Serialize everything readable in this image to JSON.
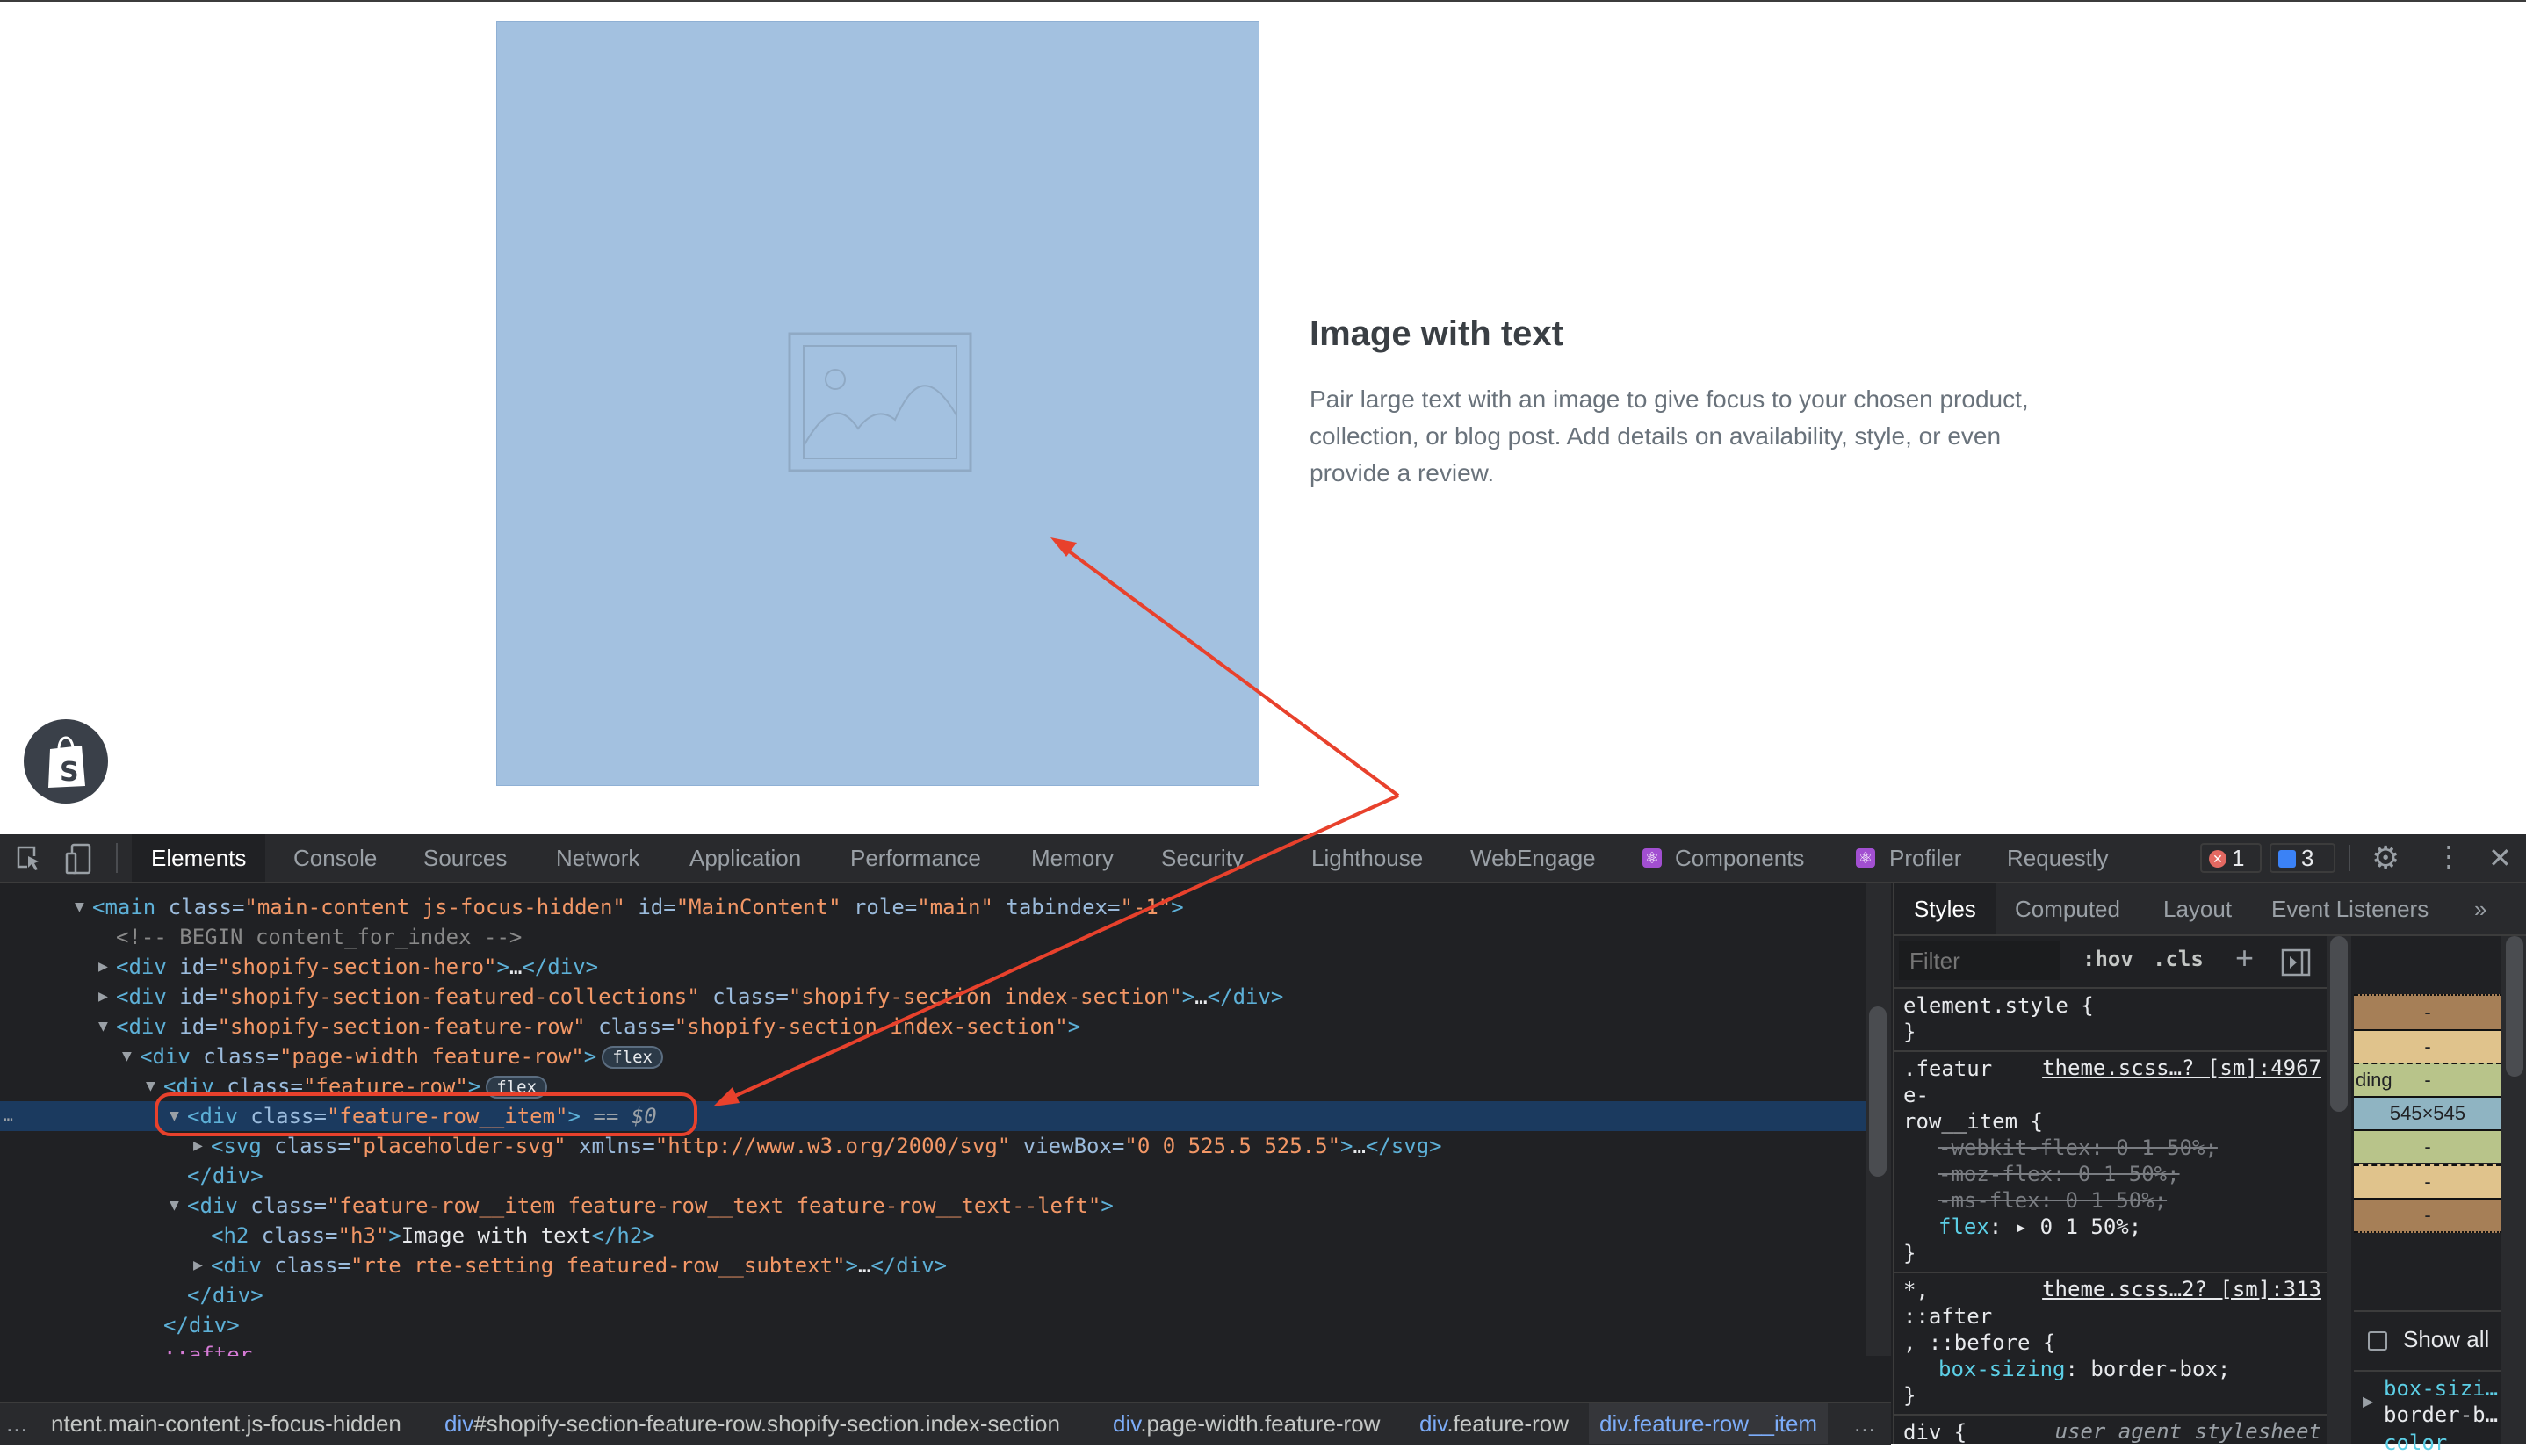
{
  "page": {
    "heading": "Image with text",
    "body": "Pair large text with an image to give focus to your chosen product, collection, or blog post. Add details on availability, style, or even provide a review.",
    "image_color": "#a3c1e0",
    "placeholder_icon": "image-placeholder-icon",
    "badge_icon": "shopify-bag-icon"
  },
  "devtools": {
    "tabs": [
      "Elements",
      "Console",
      "Sources",
      "Network",
      "Application",
      "Performance",
      "Memory",
      "Security",
      "Lighthouse",
      "WebEngage",
      "Components",
      "Profiler",
      "Requestly"
    ],
    "active_tab": "Elements",
    "error_count": "1",
    "message_count": "3",
    "elements_rows": [
      {
        "indent": 0,
        "arrow": "open",
        "tokens": [
          [
            "tag",
            "<main"
          ],
          [
            "attr",
            " class="
          ],
          [
            "val",
            "\"main-content js-focus-hidden\""
          ],
          [
            "attr",
            " id="
          ],
          [
            "val",
            "\"MainContent\""
          ],
          [
            "attr",
            " role="
          ],
          [
            "val",
            "\"main\""
          ],
          [
            "attr",
            " tabindex="
          ],
          [
            "val",
            "\"-1\""
          ],
          [
            "tag",
            ">"
          ]
        ]
      },
      {
        "indent": 1,
        "tokens": [
          [
            "comment",
            "<!-- BEGIN content_for_index -->"
          ]
        ]
      },
      {
        "indent": 1,
        "arrow": "closed",
        "tokens": [
          [
            "tag",
            "<div"
          ],
          [
            "attr",
            " id="
          ],
          [
            "val",
            "\"shopify-section-hero\""
          ],
          [
            "tag",
            ">"
          ],
          [
            "text",
            "…"
          ],
          [
            "tag",
            "</div>"
          ]
        ]
      },
      {
        "indent": 1,
        "arrow": "closed",
        "tokens": [
          [
            "tag",
            "<div"
          ],
          [
            "attr",
            " id="
          ],
          [
            "val",
            "\"shopify-section-featured-collections\""
          ],
          [
            "attr",
            " class="
          ],
          [
            "val",
            "\"shopify-section index-section\""
          ],
          [
            "tag",
            ">"
          ],
          [
            "text",
            "…"
          ],
          [
            "tag",
            "</div>"
          ]
        ]
      },
      {
        "indent": 1,
        "arrow": "open",
        "tokens": [
          [
            "tag",
            "<div"
          ],
          [
            "attr",
            " id="
          ],
          [
            "val",
            "\"shopify-section-feature-row\""
          ],
          [
            "attr",
            " class="
          ],
          [
            "val",
            "\"shopify-section index-section\""
          ],
          [
            "tag",
            ">"
          ]
        ]
      },
      {
        "indent": 2,
        "arrow": "open",
        "tokens": [
          [
            "tag",
            "<div"
          ],
          [
            "attr",
            " class="
          ],
          [
            "val",
            "\"page-width feature-row\""
          ],
          [
            "tag",
            ">"
          ],
          [
            "badge",
            "flex"
          ]
        ]
      },
      {
        "indent": 3,
        "arrow": "open",
        "tokens": [
          [
            "tag",
            "<div"
          ],
          [
            "attr",
            " class="
          ],
          [
            "val",
            "\"feature-row\""
          ],
          [
            "tag",
            ">"
          ],
          [
            "badge",
            "flex"
          ]
        ]
      },
      {
        "indent": 4,
        "arrow": "open",
        "selected": true,
        "tokens": [
          [
            "tag",
            "<div"
          ],
          [
            "attr",
            " class="
          ],
          [
            "val",
            "\"feature-row__item\""
          ],
          [
            "tag",
            ">"
          ],
          [
            "eq",
            " == $0"
          ]
        ]
      },
      {
        "indent": 5,
        "arrow": "closed",
        "tokens": [
          [
            "tag",
            "<svg"
          ],
          [
            "attr",
            " class="
          ],
          [
            "val",
            "\"placeholder-svg\""
          ],
          [
            "attr",
            " xmlns="
          ],
          [
            "val",
            "\"http://www.w3.org/2000/svg\""
          ],
          [
            "attr",
            " viewBox="
          ],
          [
            "val",
            "\"0 0 525.5 525.5\""
          ],
          [
            "tag",
            ">"
          ],
          [
            "text",
            "…"
          ],
          [
            "tag",
            "</svg>"
          ]
        ]
      },
      {
        "indent": 4,
        "tokens": [
          [
            "tag",
            "</div>"
          ]
        ]
      },
      {
        "indent": 4,
        "arrow": "open",
        "tokens": [
          [
            "tag",
            "<div"
          ],
          [
            "attr",
            " class="
          ],
          [
            "val",
            "\"feature-row__item feature-row__text feature-row__text--left\""
          ],
          [
            "tag",
            ">"
          ]
        ]
      },
      {
        "indent": 5,
        "tokens": [
          [
            "tag",
            "<h2"
          ],
          [
            "attr",
            " class="
          ],
          [
            "val",
            "\"h3\""
          ],
          [
            "tag",
            ">"
          ],
          [
            "text",
            "Image with text"
          ],
          [
            "tag",
            "</h2>"
          ]
        ]
      },
      {
        "indent": 5,
        "arrow": "closed",
        "tokens": [
          [
            "tag",
            "<div"
          ],
          [
            "attr",
            " class="
          ],
          [
            "val",
            "\"rte rte-setting featured-row__subtext\""
          ],
          [
            "tag",
            ">"
          ],
          [
            "text",
            "…"
          ],
          [
            "tag",
            "</div>"
          ]
        ]
      },
      {
        "indent": 4,
        "tokens": [
          [
            "tag",
            "</div>"
          ]
        ]
      },
      {
        "indent": 3,
        "tokens": [
          [
            "tag",
            "</div>"
          ]
        ]
      },
      {
        "indent": 3,
        "tokens": [
          [
            "pseudo",
            "::after"
          ]
        ]
      },
      {
        "indent": 2,
        "tokens": [
          [
            "tag",
            "</div>"
          ]
        ]
      }
    ],
    "breadcrumbs": [
      {
        "tag": "",
        "rest": "ntent.main-content.js-focus-hidden"
      },
      {
        "tag": "div",
        "rest": "#shopify-section-feature-row.shopify-section.index-section"
      },
      {
        "tag": "div",
        "rest": ".page-width.feature-row"
      },
      {
        "tag": "div",
        "rest": ".feature-row"
      },
      {
        "tag": "div",
        "rest": ".feature-row__item"
      }
    ],
    "styles": {
      "tabs": [
        "Styles",
        "Computed",
        "Layout",
        "Event Listeners"
      ],
      "active_tab": "Styles",
      "filter_placeholder": "Filter",
      "hov": ":hov",
      "cls": ".cls",
      "rules": [
        {
          "lines": [
            [
              [
                "sel",
                "element.style {"
              ]
            ],
            [
              [
                "sel",
                "}"
              ]
            ]
          ]
        },
        {
          "link": "theme.scss…? [sm]:4967",
          "lines": [
            [
              [
                "sel",
                ".featur"
              ]
            ],
            [
              [
                "sel",
                "e-"
              ]
            ],
            [
              [
                "sel",
                "row__item {"
              ]
            ],
            [
              [
                "strike",
                "-webkit-flex: 0 1 50%;"
              ]
            ],
            [
              [
                "strike",
                "-moz-flex: 0 1 50%;"
              ]
            ],
            [
              [
                "strike",
                "-ms-flex: 0 1 50%;"
              ]
            ],
            [
              [
                "prop",
                "flex"
              ],
              [
                "sel",
                ": ▸ 0 1 50%;"
              ]
            ],
            [
              [
                "sel",
                "}"
              ]
            ]
          ]
        },
        {
          "link": "theme.scss…2? [sm]:313",
          "lines": [
            [
              [
                "sel",
                "*,"
              ]
            ],
            [
              [
                "sel",
                "::after"
              ]
            ],
            [
              [
                "sel",
                ", ::before {"
              ]
            ],
            [
              [
                "prop",
                "box-sizing"
              ],
              [
                "sel",
                ": border-box;"
              ]
            ],
            [
              [
                "sel",
                "}"
              ]
            ]
          ]
        },
        {
          "ua": "user agent stylesheet",
          "lines": [
            [
              [
                "sel",
                "div {"
              ]
            ]
          ]
        }
      ],
      "box_model": {
        "padding_label": "ding",
        "content_size": "545×545",
        "dash": "-",
        "colors": {
          "margin": "#a67f57",
          "border": "#e0c38c",
          "padding": "#b8c48a",
          "content": "#8fb4c2"
        }
      },
      "show_all": "Show all",
      "computed": [
        "box-sizi…",
        "border-b…",
        "color"
      ]
    }
  },
  "annotation_color": "#e8412c"
}
